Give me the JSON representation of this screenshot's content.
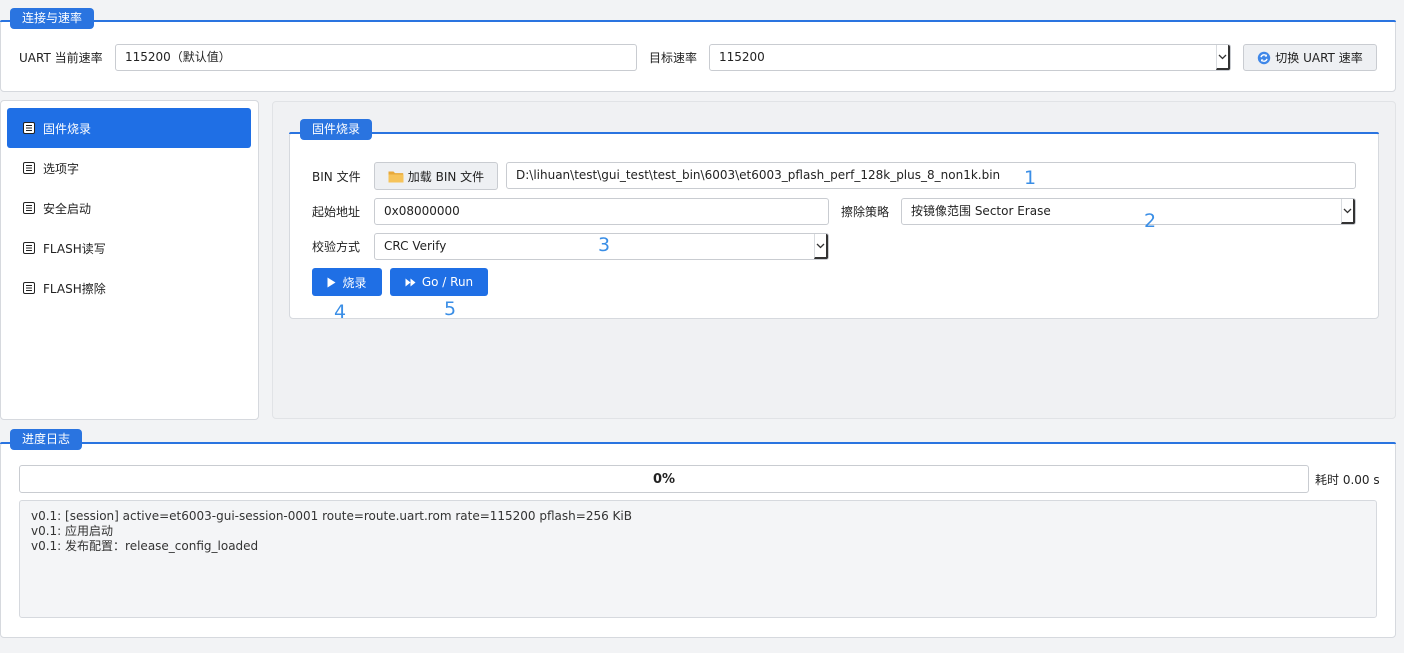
{
  "connection": {
    "title": "连接与速率",
    "uart_current_label": "UART 当前速率",
    "uart_current_value": "115200（默认值）",
    "target_rate_label": "目标速率",
    "target_rate_value": "115200",
    "switch_button": "切换 UART 速率"
  },
  "sidebar": {
    "items": [
      {
        "label": "固件烧录",
        "active": true
      },
      {
        "label": "选项字",
        "active": false
      },
      {
        "label": "安全启动",
        "active": false
      },
      {
        "label": "FLASH读写",
        "active": false
      },
      {
        "label": "FLASH擦除",
        "active": false
      }
    ]
  },
  "firmware": {
    "title": "固件烧录",
    "bin_label": "BIN 文件",
    "load_button": "加载 BIN 文件",
    "bin_path": "D:\\lihuan\\test\\gui_test\\test_bin\\6003\\et6003_pflash_perf_128k_plus_8_non1k.bin",
    "start_addr_label": "起始地址",
    "start_addr_value": "0x08000000",
    "erase_label": "擦除策略",
    "erase_value": "按镜像范围 Sector Erase",
    "verify_label": "校验方式",
    "verify_value": "CRC Verify",
    "burn_button": "烧录",
    "run_button": "Go / Run"
  },
  "annotations": [
    "1",
    "2",
    "3",
    "4",
    "5"
  ],
  "progress": {
    "title": "进度日志",
    "percent_text": "0%",
    "percent": 0,
    "elapsed": "耗时 0.00 s"
  },
  "log": {
    "lines": [
      "v0.1: [session] active=et6003-gui-session-0001 route=route.uart.rom rate=115200 pflash=256 KiB",
      "v0.1: 应用启动",
      "v0.1: 发布配置：release_config_loaded"
    ]
  },
  "colors": {
    "accent": "#1f6fe5",
    "annotation": "#3a8ee6",
    "background": "#f2f3f5"
  }
}
